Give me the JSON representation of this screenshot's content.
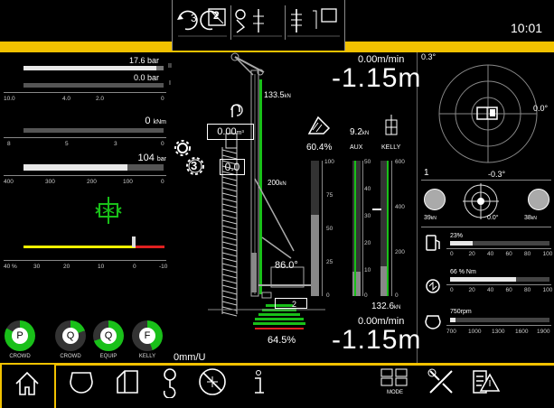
{
  "header": {
    "time": "10:01",
    "mode_digit": "3",
    "mode_box": "2"
  },
  "left": {
    "bar1_value": "17.6 bar",
    "bar1_roman": "II",
    "bar2_value": "0.0 bar",
    "bar2_roman": "I",
    "scale1": [
      "10.0",
      "4.0",
      "2.0",
      "0"
    ],
    "torque_value": "0",
    "torque_unit": "kNm",
    "scale2": [
      "8",
      "5",
      "3",
      "0"
    ],
    "pressure_value": "104",
    "pressure_unit": "bar",
    "scale3": [
      "400",
      "300",
      "200",
      "100",
      "0"
    ],
    "scale4": [
      "40",
      "%",
      "30",
      "20",
      "10",
      "0",
      "-10"
    ],
    "gauges": [
      {
        "letter": "P",
        "name": "CROWD"
      },
      {
        "letter": "Q",
        "name": "CROWD"
      },
      {
        "letter": "Q",
        "name": "EQUIP"
      },
      {
        "letter": "F",
        "name": "KELLY"
      }
    ],
    "feed_value": "0mm/U",
    "bar1_fill": 0.95,
    "bar2_fill": 0.0,
    "torque_fill": 0.0,
    "pressure_fill": 0.74
  },
  "center": {
    "speed_top": "0.00m/min",
    "depth_top": "-1.15m",
    "top_force": "133.5",
    "top_force_unit": "kN",
    "volume": "0.00",
    "volume_unit": "m³",
    "gear": "3",
    "rotary_value": "0.0",
    "mid_force": "200",
    "mid_force_unit": "kN",
    "mast_angle": "86.0°",
    "tilt_value": "2",
    "lower_pct": "64.5%",
    "winch_pct": "60.4%",
    "aux_value": "9.2",
    "aux_unit": "kN",
    "aux_label": "AUX",
    "kelly_label": "KELLY",
    "scale_pct": [
      "100",
      "75",
      "50",
      "25",
      "0"
    ],
    "scale_aux": [
      "50",
      "40",
      "30",
      "20",
      "10",
      "0"
    ],
    "scale_kelly": [
      "600",
      "400",
      "200",
      "0"
    ],
    "kelly_force": "132.6",
    "kelly_force_unit": "kN",
    "speed_bottom": "0.00m/min",
    "depth_bottom": "-1.15m",
    "pct_fill": 0.6,
    "aux_fill": 0.18,
    "kelly_fill": 0.22
  },
  "right": {
    "angle_top_left": "0.3°",
    "angle_right": "0.0°",
    "ring_value": "1",
    "ring_angle": "-0.3°",
    "left_force": "39",
    "left_force_unit": "kN",
    "center_angle": "0.0°",
    "right_force": "38",
    "right_force_unit": "kN",
    "fuel_pct": "23",
    "fuel_unit": "%",
    "load_value": "66 % Nm",
    "rpm_value": "750",
    "rpm_unit": "rpm",
    "scale_100": [
      "0",
      "20",
      "40",
      "60",
      "80",
      "100"
    ],
    "scale_rpm": [
      "700",
      "1000",
      "1300",
      "1600",
      "1900"
    ],
    "fuel_fill": 0.23,
    "load_fill": 0.66,
    "rpm_fill": 0.05
  },
  "nav": {
    "mode_label": "MODE"
  },
  "colors": {
    "accent": "#f2c200",
    "green": "#19c019",
    "yellow_line": "#f2f200",
    "red_line": "#e02020"
  }
}
